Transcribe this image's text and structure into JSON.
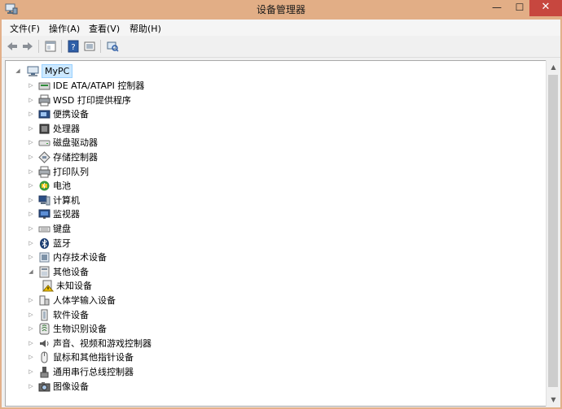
{
  "window": {
    "title": "设备管理器",
    "close_glyph": "✕",
    "min_glyph": "—",
    "max_glyph": "☐"
  },
  "menu": [
    {
      "label": "文件(F)"
    },
    {
      "label": "操作(A)"
    },
    {
      "label": "查看(V)"
    },
    {
      "label": "帮助(H)"
    }
  ],
  "toolbar": {
    "buttons": [
      "back-arrow-icon",
      "forward-arrow-icon",
      "properties-icon",
      "help-icon",
      "update-driver-icon",
      "scan-hardware-icon"
    ]
  },
  "tree": {
    "root": {
      "label": "MyPC",
      "icon": "computer-icon"
    },
    "nodes": [
      {
        "label": "IDE ATA/ATAPI 控制器",
        "icon": "ide-controller-icon",
        "expanded": false
      },
      {
        "label": "WSD 打印提供程序",
        "icon": "printer-icon",
        "expanded": false
      },
      {
        "label": "便携设备",
        "icon": "portable-device-icon",
        "expanded": false
      },
      {
        "label": "处理器",
        "icon": "processor-icon",
        "expanded": false
      },
      {
        "label": "磁盘驱动器",
        "icon": "disk-drive-icon",
        "expanded": false
      },
      {
        "label": "存储控制器",
        "icon": "storage-controller-icon",
        "expanded": false
      },
      {
        "label": "打印队列",
        "icon": "print-queue-icon",
        "expanded": false
      },
      {
        "label": "电池",
        "icon": "battery-icon",
        "expanded": false
      },
      {
        "label": "计算机",
        "icon": "computer-icon",
        "expanded": false
      },
      {
        "label": "监视器",
        "icon": "monitor-icon",
        "expanded": false
      },
      {
        "label": "键盘",
        "icon": "keyboard-icon",
        "expanded": false
      },
      {
        "label": "蓝牙",
        "icon": "bluetooth-icon",
        "expanded": false
      },
      {
        "label": "内存技术设备",
        "icon": "memory-device-icon",
        "expanded": false
      },
      {
        "label": "其他设备",
        "icon": "other-device-icon",
        "expanded": true
      },
      {
        "label": "未知设备",
        "icon": "unknown-device-warning-icon",
        "child": true
      },
      {
        "label": "人体学输入设备",
        "icon": "hid-icon",
        "expanded": false
      },
      {
        "label": "软件设备",
        "icon": "software-device-icon",
        "expanded": false
      },
      {
        "label": "生物识别设备",
        "icon": "biometric-icon",
        "expanded": false
      },
      {
        "label": "声音、视频和游戏控制器",
        "icon": "sound-icon",
        "expanded": false
      },
      {
        "label": "鼠标和其他指针设备",
        "icon": "mouse-icon",
        "expanded": false
      },
      {
        "label": "通用串行总线控制器",
        "icon": "usb-icon",
        "expanded": false
      },
      {
        "label": "图像设备",
        "icon": "imaging-device-icon",
        "expanded": false
      }
    ]
  },
  "colors": {
    "titlebar": "#e2ae86",
    "close": "#c7473f",
    "selection": "#cce8ff"
  }
}
